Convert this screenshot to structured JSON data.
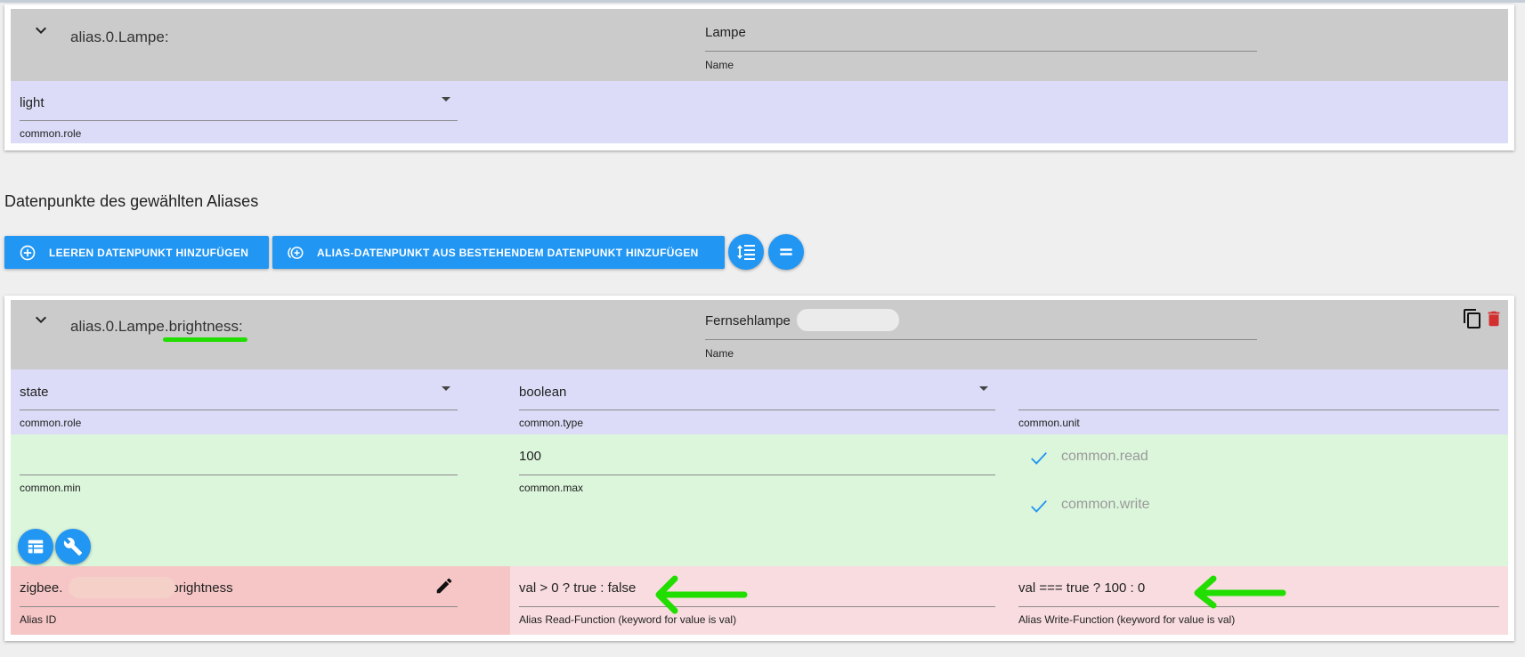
{
  "alias": {
    "title": "alias.0.Lampe:",
    "name_value": "Lampe",
    "name_label": "Name",
    "role_value": "light",
    "role_label": "common.role"
  },
  "section": {
    "title": "Datenpunkte des gewählten Aliases"
  },
  "toolbar": {
    "add_empty_label": "LEEREN DATENPUNKT HINZUFÜGEN",
    "add_existing_label": "ALIAS-DATENPUNKT AUS BESTEHENDEM DATENPUNKT HINZUFÜGEN",
    "icons": [
      "add-circle-icon",
      "add-circle-multiple-icon",
      "sort-lines-icon",
      "equal-icon"
    ]
  },
  "datapoint": {
    "title_prefix": "alias.0.Lampe.",
    "title_highlight": "brightness",
    "title_suffix": ":",
    "name_value": "Fernsehlampe",
    "name_label": "Name",
    "role_value": "state",
    "role_label": "common.role",
    "type_value": "boolean",
    "type_label": "common.type",
    "unit_value": "",
    "unit_label": "common.unit",
    "min_value": "",
    "min_label": "common.min",
    "max_value": "100",
    "max_label": "common.max",
    "read_label": "common.read",
    "write_label": "common.write",
    "alias_id_prefix": "zigbee.",
    "alias_id_suffix": "brightness",
    "alias_id_label": "Alias ID",
    "read_fn_value": "val > 0 ? true : false",
    "read_fn_label": "Alias Read-Function (keyword for value is val)",
    "write_fn_value": "val === true ? 100 : 0",
    "write_fn_label": "Alias Write-Function (keyword for value is val)"
  },
  "colors": {
    "accent": "#2196f3",
    "header_bg": "#cbcbcb",
    "row_blue": "#dcdcf8",
    "row_green": "#dcf6dc",
    "row_pink": "#f8dcdf",
    "row_red": "#f6c6c6",
    "annotation_green": "#22dd00",
    "delete_red": "#d32f2f"
  }
}
